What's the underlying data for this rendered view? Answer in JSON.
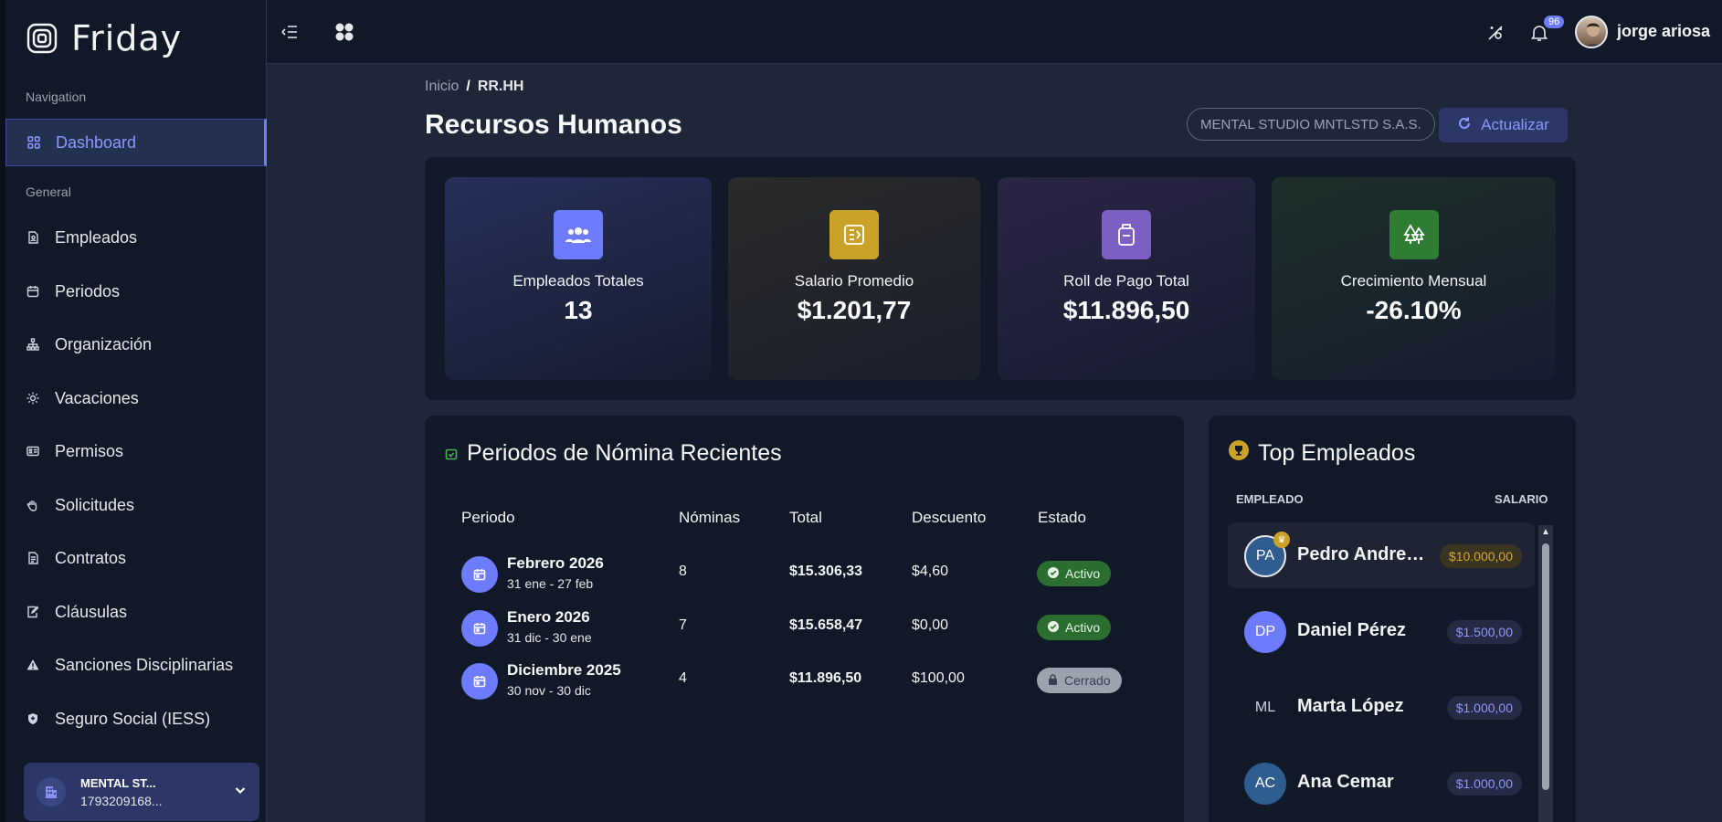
{
  "app": {
    "name": "Friday"
  },
  "sidebar": {
    "sections": [
      "Navigation",
      "General"
    ],
    "items": [
      {
        "label": "Dashboard",
        "icon": "grid-icon"
      },
      {
        "label": "Empleados",
        "icon": "file-user-icon"
      },
      {
        "label": "Periodos",
        "icon": "calendar-icon"
      },
      {
        "label": "Organización",
        "icon": "hierarchy-icon"
      },
      {
        "label": "Vacaciones",
        "icon": "sun-icon"
      },
      {
        "label": "Permisos",
        "icon": "id-card-icon"
      },
      {
        "label": "Solicitudes",
        "icon": "hand-icon"
      },
      {
        "label": "Contratos",
        "icon": "document-icon"
      },
      {
        "label": "Cláusulas",
        "icon": "edit-doc-icon"
      },
      {
        "label": "Sanciones Disciplinarias",
        "icon": "warning-icon"
      },
      {
        "label": "Seguro Social (IESS)",
        "icon": "shield-icon"
      }
    ],
    "company": {
      "name": "MENTAL ST...",
      "id": "1793209168..."
    }
  },
  "topbar": {
    "notifications_count": "96",
    "user_name": "jorge ariosa"
  },
  "breadcrumb": {
    "home": "Inicio",
    "sep": "/",
    "current": "RR.HH"
  },
  "page": {
    "title": "Recursos Humanos",
    "company_pill": "MENTAL STUDIO MNTLSTD S.A.S.",
    "refresh_label": "Actualizar"
  },
  "stats": [
    {
      "label": "Empleados Totales",
      "value": "13",
      "icon": "users-icon",
      "color": "#6d7cff"
    },
    {
      "label": "Salario Promedio",
      "value": "$1.201,77",
      "icon": "money-icon",
      "color": "#c9a227"
    },
    {
      "label": "Roll de Pago Total",
      "value": "$11.896,50",
      "icon": "wallet-icon",
      "color": "#7b5fc2"
    },
    {
      "label": "Crecimiento Mensual",
      "value": "-26.10%",
      "icon": "trees-icon",
      "color": "#2e7d32"
    }
  ],
  "periods": {
    "title": "Periodos de Nómina Recientes",
    "headers": {
      "periodo": "Periodo",
      "nominas": "Nóminas",
      "total": "Total",
      "descuento": "Descuento",
      "estado": "Estado"
    },
    "rows": [
      {
        "name": "Febrero 2026",
        "range": "31 ene - 27 feb",
        "nominas": "8",
        "total": "$15.306,33",
        "descuento": "$4,60",
        "estado": "Activo"
      },
      {
        "name": "Enero 2026",
        "range": "31 dic - 30 ene",
        "nominas": "7",
        "total": "$15.658,47",
        "descuento": "$0,00",
        "estado": "Activo"
      },
      {
        "name": "Diciembre 2025",
        "range": "30 nov - 30 dic",
        "nominas": "4",
        "total": "$11.896,50",
        "descuento": "$100,00",
        "estado": "Cerrado"
      }
    ]
  },
  "top_employees": {
    "title": "Top Empleados",
    "headers": {
      "empleado": "EMPLEADO",
      "salario": "SALARIO"
    },
    "rows": [
      {
        "initials": "PA",
        "name": "Pedro Andres ...",
        "salary": "$10.000,00"
      },
      {
        "initials": "DP",
        "name": "Daniel Pérez",
        "salary": "$1.500,00"
      },
      {
        "initials": "ML",
        "name": "Marta López",
        "salary": "$1.000,00"
      },
      {
        "initials": "AC",
        "name": "Ana Cemar",
        "salary": "$1.000,00"
      }
    ]
  }
}
